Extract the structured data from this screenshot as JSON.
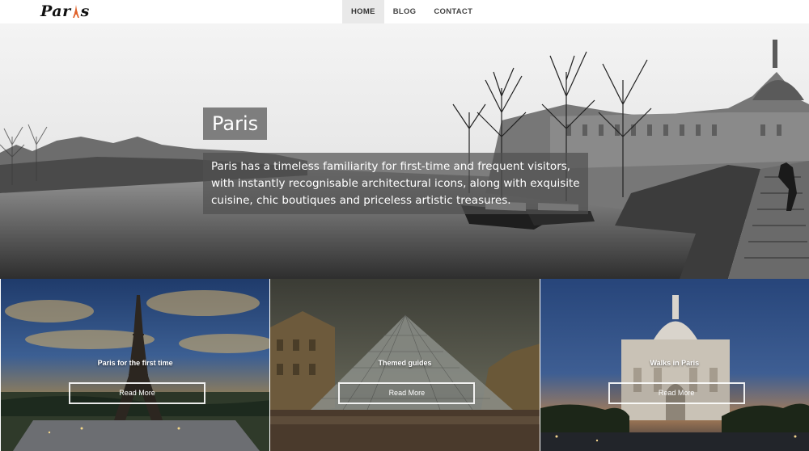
{
  "header": {
    "logo_text_left": "Par",
    "logo_text_right": "s",
    "nav": [
      {
        "label": "HOME",
        "active": true
      },
      {
        "label": "BLOG",
        "active": false
      },
      {
        "label": "CONTACT",
        "active": false
      }
    ]
  },
  "hero": {
    "title": "Paris",
    "text": "Paris has a timeless familiarity for first-time and frequent visitors, with instantly recognisable architectural icons, along with exquisite cuisine, chic boutiques and priceless artistic treasures."
  },
  "cards": [
    {
      "title": "Paris for the first time",
      "button": "Read More"
    },
    {
      "title": "Themed guides",
      "button": "Read More"
    },
    {
      "title": "Walks in Paris",
      "button": "Read More"
    }
  ],
  "colors": {
    "logo_accent": "#e0622a",
    "nav_active_bg": "#e9e9e9"
  }
}
